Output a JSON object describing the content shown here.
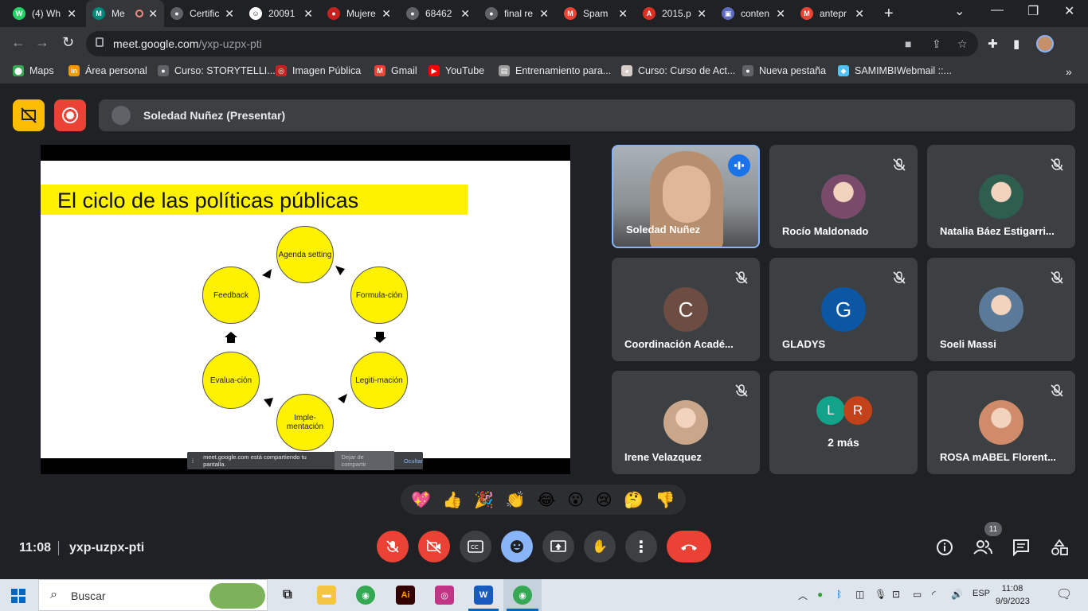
{
  "browser": {
    "tabs": [
      {
        "label": "(4) Wh",
        "fav_color": "#25d366",
        "fav_glyph": "W"
      },
      {
        "label": "Me",
        "fav_color": "#00897b",
        "fav_glyph": "M",
        "active": true
      },
      {
        "label": "Certific",
        "fav_color": "#5f6368",
        "fav_glyph": "●"
      },
      {
        "label": "20091",
        "fav_color": "#ffffff",
        "fav_glyph": "☺"
      },
      {
        "label": "Mujere",
        "fav_color": "#c5221f",
        "fav_glyph": "●"
      },
      {
        "label": "68462",
        "fav_color": "#5f6368",
        "fav_glyph": "●"
      },
      {
        "label": "final re",
        "fav_color": "#5f6368",
        "fav_glyph": "●"
      },
      {
        "label": "Spam",
        "fav_color": "#ea4335",
        "fav_glyph": "M"
      },
      {
        "label": "2015.p",
        "fav_color": "#d93025",
        "fav_glyph": "A"
      },
      {
        "label": "conten",
        "fav_color": "#5c6bc0",
        "fav_glyph": "▣"
      },
      {
        "label": "antepr",
        "fav_color": "#ea4335",
        "fav_glyph": "M"
      }
    ],
    "url_host": "meet.google.com",
    "url_path": "/yxp-uzpx-pti",
    "bookmarks": [
      {
        "label": "Maps",
        "color": "#34a853",
        "glyph": "⬤"
      },
      {
        "label": "Área personal",
        "color": "#f29900",
        "glyph": "in"
      },
      {
        "label": "Curso: STORYTELLI...",
        "color": "#5f6368",
        "glyph": "●"
      },
      {
        "label": "Imagen Pública",
        "color": "#c5221f",
        "glyph": "◎"
      },
      {
        "label": "Gmail",
        "color": "#ea4335",
        "glyph": "M"
      },
      {
        "label": "YouTube",
        "color": "#ff0000",
        "glyph": "▶"
      },
      {
        "label": "Entrenamiento para...",
        "color": "#9e9e9e",
        "glyph": "▤"
      },
      {
        "label": "Curso: Curso de Act...",
        "color": "#d7ccc8",
        "glyph": "◕"
      },
      {
        "label": "Nueva pestaña",
        "color": "#5f6368",
        "glyph": "●"
      },
      {
        "label": "SAMIMBIWebmail ::...",
        "color": "#4fc3f7",
        "glyph": "◆"
      }
    ]
  },
  "meet": {
    "presenter_label": "Soledad Nuñez (Presentar)",
    "meeting_time": "11:08",
    "meeting_code": "yxp-uzpx-pti",
    "participant_count": "11",
    "slide": {
      "title": "El ciclo de las políticas públicas",
      "nodes": [
        {
          "label": "Agenda setting"
        },
        {
          "label": "Formula-ción"
        },
        {
          "label": "Legiti-mación"
        },
        {
          "label": "Imple-mentación"
        },
        {
          "label": "Evalua-ción"
        },
        {
          "label": "Feedback"
        }
      ]
    },
    "share_notice": {
      "message": "meet.google.com está compartiendo tu pantalla.",
      "stop_label": "Dejar de compartir",
      "hide_label": "Ocultar"
    },
    "participants": [
      {
        "name": "Soledad Nuñez",
        "speaking": true
      },
      {
        "name": "Rocío Maldonado",
        "avatar": "photo",
        "color": "#7a4a6a"
      },
      {
        "name": "Natalia Báez Estigarri...",
        "avatar": "photo",
        "color": "#2e5e4e"
      },
      {
        "name": "Coordinación Acadé...",
        "avatar": "letter",
        "letter": "C",
        "color": "#6d4c41"
      },
      {
        "name": "GLADYS",
        "avatar": "letter",
        "letter": "G",
        "color": "#0b57a4"
      },
      {
        "name": "Soeli Massi",
        "avatar": "photo",
        "color": "#5b7a99"
      },
      {
        "name": "Irene Velazquez",
        "avatar": "photo",
        "color": "#caa68a"
      },
      {
        "name": "2 más",
        "avatar": "group",
        "letters": [
          "L",
          "R"
        ],
        "colors": [
          "#12a38a",
          "#c4421a"
        ]
      },
      {
        "name": "ROSA mABEL Florent...",
        "avatar": "photo",
        "color": "#d08b6a"
      }
    ],
    "reactions": [
      "💖",
      "👍",
      "🎉",
      "👏",
      "😂",
      "😮",
      "😢",
      "🤔",
      "👎"
    ],
    "colors": {
      "accent": "#8ab4f8",
      "danger": "#ea4335",
      "hangup": "#ea4335",
      "warning": "#fbbc04"
    }
  },
  "taskbar": {
    "search_placeholder": "Buscar",
    "lang": "ESP",
    "time": "11:08",
    "date": "9/9/2023"
  }
}
